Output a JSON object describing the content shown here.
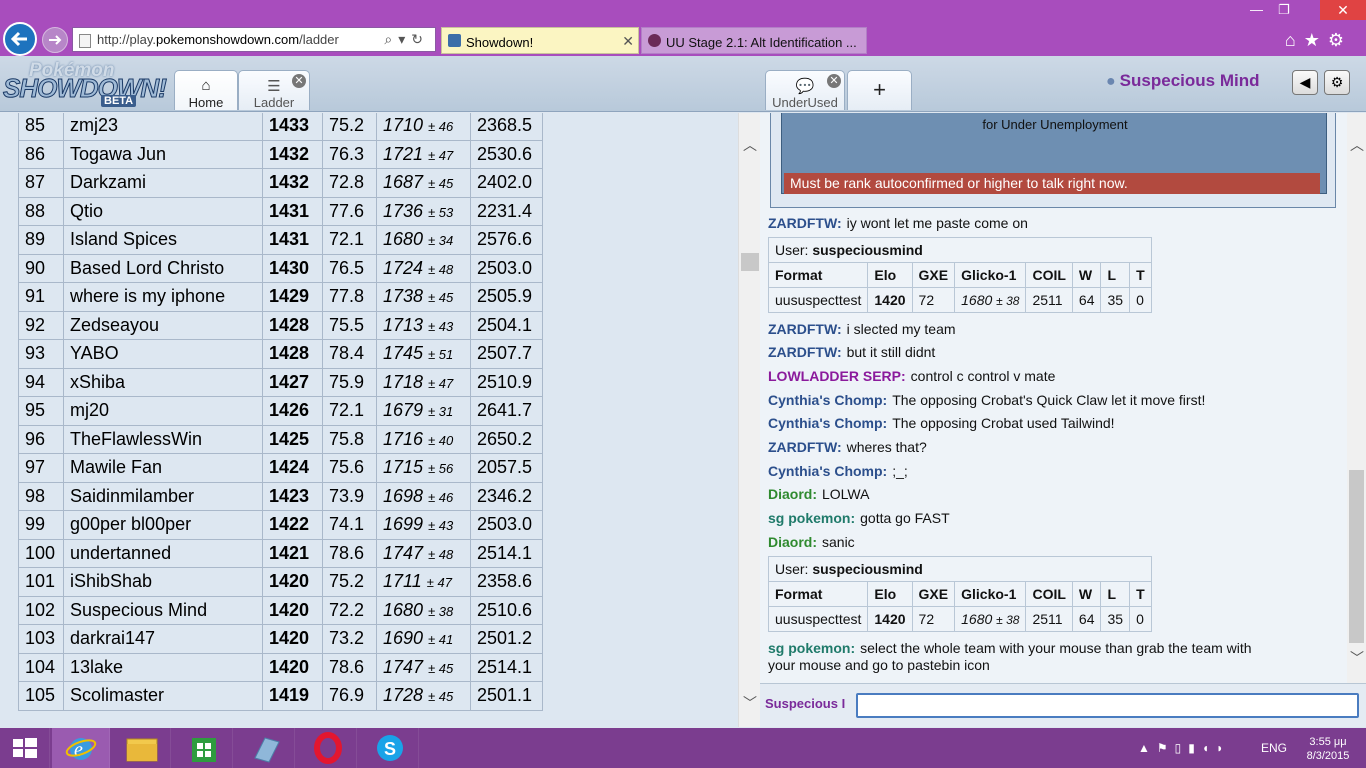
{
  "browser": {
    "url_prefix": "http://play.",
    "url_domain": "pokemonshowdown.com",
    "url_suffix": "/ladder",
    "tabs": [
      {
        "title": "Showdown!",
        "close": "✕"
      },
      {
        "title": "UU Stage 2.1: Alt Identification ..."
      }
    ],
    "window_controls": {
      "minimize": "—",
      "restore": "❐",
      "close": "✕"
    }
  },
  "header": {
    "logo_top": "Pokémon",
    "logo_main": "SHOWDOWN!",
    "logo_beta": "BETA",
    "tabs": [
      {
        "label": "Home",
        "icon": "⌂"
      },
      {
        "label": "Ladder",
        "icon": "☰",
        "close": "✕"
      },
      {
        "label": "UnderUsed",
        "icon": "💬",
        "close": "✕"
      },
      {
        "label": "+"
      }
    ],
    "username": "Suspecious Mind",
    "sound_icon": "◀",
    "gear_icon": "⚙"
  },
  "ladder": {
    "rows": [
      {
        "rank": "85",
        "name": "zmj23",
        "elo": "1433",
        "gxe": "75.2",
        "glicko": "1710",
        "dev": "± 46",
        "coil": "2368.5"
      },
      {
        "rank": "86",
        "name": "Togawa Jun",
        "elo": "1432",
        "gxe": "76.3",
        "glicko": "1721",
        "dev": "± 47",
        "coil": "2530.6"
      },
      {
        "rank": "87",
        "name": "Darkzami",
        "elo": "1432",
        "gxe": "72.8",
        "glicko": "1687",
        "dev": "± 45",
        "coil": "2402.0"
      },
      {
        "rank": "88",
        "name": "Qtio",
        "elo": "1431",
        "gxe": "77.6",
        "glicko": "1736",
        "dev": "± 53",
        "coil": "2231.4"
      },
      {
        "rank": "89",
        "name": "Island Spices",
        "elo": "1431",
        "gxe": "72.1",
        "glicko": "1680",
        "dev": "± 34",
        "coil": "2576.6"
      },
      {
        "rank": "90",
        "name": "Based Lord Christo",
        "elo": "1430",
        "gxe": "76.5",
        "glicko": "1724",
        "dev": "± 48",
        "coil": "2503.0"
      },
      {
        "rank": "91",
        "name": "where is my iphone",
        "elo": "1429",
        "gxe": "77.8",
        "glicko": "1738",
        "dev": "± 45",
        "coil": "2505.9"
      },
      {
        "rank": "92",
        "name": "Zedseayou",
        "elo": "1428",
        "gxe": "75.5",
        "glicko": "1713",
        "dev": "± 43",
        "coil": "2504.1"
      },
      {
        "rank": "93",
        "name": "YABO",
        "elo": "1428",
        "gxe": "78.4",
        "glicko": "1745",
        "dev": "± 51",
        "coil": "2507.7"
      },
      {
        "rank": "94",
        "name": "xShiba",
        "elo": "1427",
        "gxe": "75.9",
        "glicko": "1718",
        "dev": "± 47",
        "coil": "2510.9"
      },
      {
        "rank": "95",
        "name": "mj20",
        "elo": "1426",
        "gxe": "72.1",
        "glicko": "1679",
        "dev": "± 31",
        "coil": "2641.7"
      },
      {
        "rank": "96",
        "name": "TheFlawlessWin",
        "elo": "1425",
        "gxe": "75.8",
        "glicko": "1716",
        "dev": "± 40",
        "coil": "2650.2"
      },
      {
        "rank": "97",
        "name": "Mawile Fan",
        "elo": "1424",
        "gxe": "75.6",
        "glicko": "1715",
        "dev": "± 56",
        "coil": "2057.5"
      },
      {
        "rank": "98",
        "name": "Saidinmilamber",
        "elo": "1423",
        "gxe": "73.9",
        "glicko": "1698",
        "dev": "± 46",
        "coil": "2346.2"
      },
      {
        "rank": "99",
        "name": "g00per bl00per",
        "elo": "1422",
        "gxe": "74.1",
        "glicko": "1699",
        "dev": "± 43",
        "coil": "2503.0"
      },
      {
        "rank": "100",
        "name": "undertanned",
        "elo": "1421",
        "gxe": "78.6",
        "glicko": "1747",
        "dev": "± 48",
        "coil": "2514.1"
      },
      {
        "rank": "101",
        "name": "iShibShab",
        "elo": "1420",
        "gxe": "75.2",
        "glicko": "1711",
        "dev": "± 47",
        "coil": "2358.6"
      },
      {
        "rank": "102",
        "name": "Suspecious Mind",
        "elo": "1420",
        "gxe": "72.2",
        "glicko": "1680",
        "dev": "± 38",
        "coil": "2510.6"
      },
      {
        "rank": "103",
        "name": "darkrai147",
        "elo": "1420",
        "gxe": "73.2",
        "glicko": "1690",
        "dev": "± 41",
        "coil": "2501.2"
      },
      {
        "rank": "104",
        "name": "13lake",
        "elo": "1420",
        "gxe": "78.6",
        "glicko": "1747",
        "dev": "± 45",
        "coil": "2514.1"
      },
      {
        "rank": "105",
        "name": "Scolimaster",
        "elo": "1419",
        "gxe": "76.9",
        "glicko": "1728",
        "dev": "± 45",
        "coil": "2501.1"
      }
    ]
  },
  "chat": {
    "notice_text": "for Under Unemployment",
    "rank_warning": "Must be rank autoconfirmed or higher to talk right now.",
    "messages": [
      {
        "user": "ZARDFTW:",
        "text": "iy wont let me paste come on",
        "color": "#2c4f8c"
      },
      {
        "user": "ZARDFTW:",
        "text": "i slected my team",
        "color": "#2c4f8c"
      },
      {
        "user": "ZARDFTW:",
        "text": "but it still didnt",
        "color": "#2c4f8c"
      },
      {
        "user": "LOWLADDER SERP:",
        "text": "control c control v mate",
        "color": "#8b1a9c"
      },
      {
        "user": "Cynthia's Chomp:",
        "text": "The opposing Crobat's Quick Claw let it move first!",
        "color": "#2c4f8c"
      },
      {
        "user": "Cynthia's Chomp:",
        "text": "The opposing Crobat used Tailwind!",
        "color": "#2c4f8c"
      },
      {
        "user": "ZARDFTW:",
        "text": "wheres that?",
        "color": "#2c4f8c"
      },
      {
        "user": "Cynthia's Chomp:",
        "text": ";_;",
        "color": "#2c4f8c"
      },
      {
        "user": "Diaord:",
        "text": "LOLWA",
        "color": "#2f8a2f"
      },
      {
        "user": "sg pokemon:",
        "text": "gotta go FAST",
        "color": "#1f7a6a"
      },
      {
        "user": "Diaord:",
        "text": "sanic",
        "color": "#2f8a2f"
      },
      {
        "user": "sg pokemon:",
        "text": "select the whole team with your mouse than grab the team with",
        "color": "#1f7a6a"
      }
    ],
    "last_line_cont": "your mouse and go to pastebin icon",
    "rank_card": {
      "user_label": "User:",
      "user_name": "suspeciousmind",
      "headers": [
        "Format",
        "Elo",
        "GXE",
        "Glicko-1",
        "COIL",
        "W",
        "L",
        "T"
      ],
      "format": "uususpecttest",
      "elo": "1420",
      "gxe": "72",
      "glicko": "1680",
      "dev": "± 38",
      "coil": "2511",
      "w": "64",
      "l": "35",
      "t": "0"
    },
    "input_user": "Suspecious I"
  },
  "taskbar": {
    "tray_lang": "ENG",
    "time": "3:55 μμ",
    "date": "8/3/2015"
  }
}
